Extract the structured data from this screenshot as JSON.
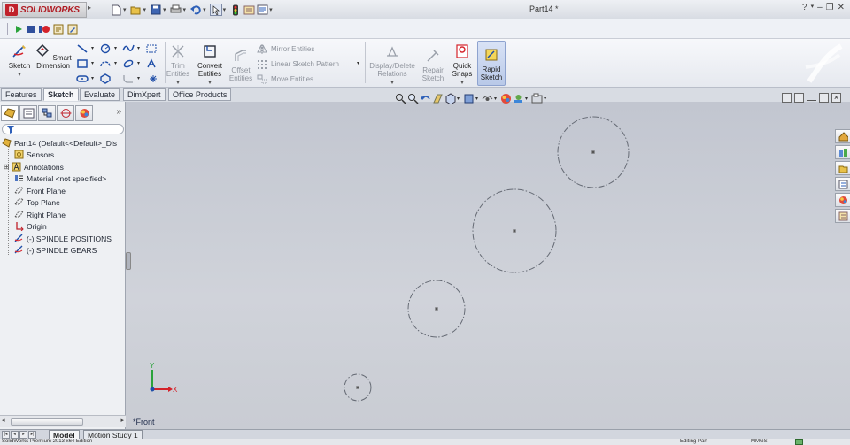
{
  "app": {
    "brand": "SOLIDWORKS",
    "window_title": "Part14 *"
  },
  "colors": {
    "accent_red": "#c0212b",
    "sketch_blue": "#1f4ea8",
    "canvas": "#c9ccd4",
    "sketch_gray": "#666b75"
  },
  "icons": {
    "quick_access": [
      "new-document-icon",
      "open-icon",
      "save-icon",
      "print-icon",
      "undo-icon",
      "select-icon",
      "rebuild-icon",
      "file-properties-icon",
      "options-icon"
    ],
    "window": [
      "help-icon",
      "minimize-icon",
      "restore-icon",
      "close-icon"
    ]
  },
  "runbar": {
    "items": [
      "play-icon",
      "stop-icon",
      "record-icon",
      "macro-new-icon",
      "macro-edit-icon"
    ]
  },
  "commands": {
    "sketch": "Sketch",
    "smart_dimension": [
      "Smart",
      "Dimension"
    ],
    "trim": [
      "Trim",
      "Entities"
    ],
    "convert": [
      "Convert",
      "Entities"
    ],
    "offset": [
      "Offset",
      "Entities"
    ],
    "mirror": "Mirror Entities",
    "linear_pattern": "Linear Sketch Pattern",
    "move": "Move Entities",
    "display_delete": [
      "Display/Delete",
      "Relations"
    ],
    "repair": [
      "Repair",
      "Sketch"
    ],
    "quick_snaps": [
      "Quick",
      "Snaps"
    ],
    "rapid_sketch": [
      "Rapid",
      "Sketch"
    ]
  },
  "tabs": [
    "Features",
    "Sketch",
    "Evaluate",
    "DimXpert",
    "Office Products"
  ],
  "active_tab": "Sketch",
  "feature_tree": {
    "root": "Part14  (Default<<Default>_Dis",
    "items": [
      {
        "label": "Sensors",
        "icon": "sensors-icon"
      },
      {
        "label": "Annotations",
        "icon": "annotations-icon"
      },
      {
        "label": "Material <not specified>",
        "icon": "material-icon"
      },
      {
        "label": "Front Plane",
        "icon": "plane-icon"
      },
      {
        "label": "Top Plane",
        "icon": "plane-icon"
      },
      {
        "label": "Right Plane",
        "icon": "plane-icon"
      },
      {
        "label": "Origin",
        "icon": "origin-icon"
      },
      {
        "label": "(-) SPINDLE POSITIONS",
        "icon": "sketch-icon"
      },
      {
        "label": "(-) SPINDLE GEARS",
        "icon": "sketch-icon"
      }
    ]
  },
  "graphics": {
    "view_name": "*Front",
    "triad": {
      "x": "X",
      "y": "Y"
    }
  },
  "bottom_tabs": [
    "Model",
    "Motion Study 1"
  ],
  "status": {
    "left": "SolidWorks Premium 2013 x64 Edition",
    "right": "Editing Part",
    "units": "MMGS"
  }
}
